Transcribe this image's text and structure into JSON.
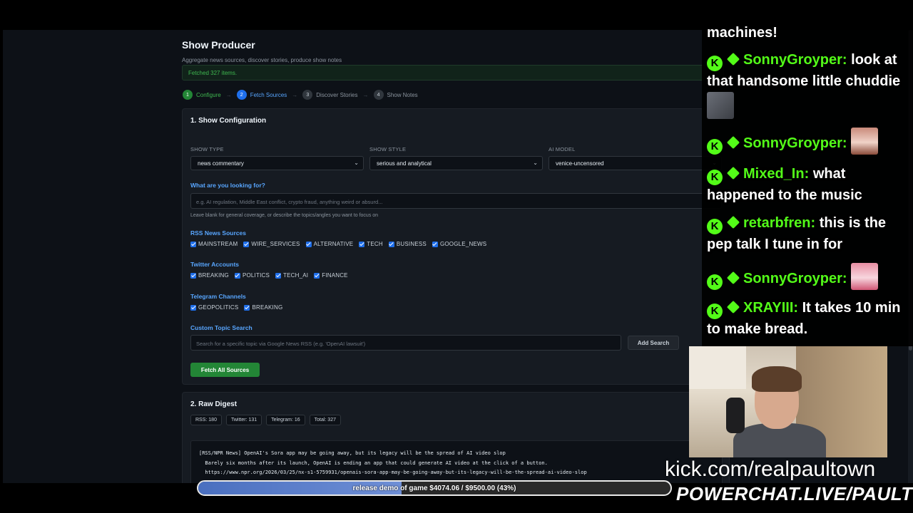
{
  "app": {
    "title": "Show Producer",
    "subtitle": "Aggregate news sources, discover stories, produce show notes",
    "status": "Fetched 327 items."
  },
  "steps": [
    {
      "num": "1",
      "label": "Configure",
      "state": "done"
    },
    {
      "num": "2",
      "label": "Fetch Sources",
      "state": "active"
    },
    {
      "num": "3",
      "label": "Discover Stories",
      "state": "pending"
    },
    {
      "num": "4",
      "label": "Show Notes",
      "state": "pending"
    }
  ],
  "config": {
    "heading": "1. Show Configuration",
    "show_type": {
      "label": "SHOW TYPE",
      "value": "news commentary"
    },
    "show_style": {
      "label": "SHOW STYLE",
      "value": "serious and analytical"
    },
    "ai_model": {
      "label": "AI MODEL",
      "value": "venice-uncensored"
    },
    "looking_for": {
      "label": "What are you looking for?",
      "placeholder": "e.g. AI regulation, Middle East conflict, crypto fraud, anything weird or absurd...",
      "hint": "Leave blank for general coverage, or describe the topics/angles you want to focus on"
    },
    "rss": {
      "label": "RSS News Sources",
      "items": [
        "MAINSTREAM",
        "WIRE_SERVICES",
        "ALTERNATIVE",
        "TECH",
        "BUSINESS",
        "GOOGLE_NEWS"
      ]
    },
    "twitter": {
      "label": "Twitter Accounts",
      "items": [
        "BREAKING",
        "POLITICS",
        "TECH_AI",
        "FINANCE"
      ]
    },
    "telegram": {
      "label": "Telegram Channels",
      "items": [
        "GEOPOLITICS",
        "BREAKING"
      ]
    },
    "custom": {
      "label": "Custom Topic Search",
      "placeholder": "Search for a specific topic via Google News RSS (e.g. 'OpenAI lawsuit')",
      "button": "Add Search"
    },
    "fetch_button": "Fetch All Sources"
  },
  "digest": {
    "heading": "2. Raw Digest",
    "stats": [
      "RSS: 180",
      "Twitter: 131",
      "Telegram: 16",
      "Total: 327"
    ],
    "line1": "[RSS/NPR News] OpenAI's Sora app may be going away, but its legacy will be the spread of AI video slop",
    "line2": "  Barely six months after its launch, OpenAI is ending an app that could generate AI video at the click of a button.",
    "line3": "  https://www.npr.org/2026/03/25/nx-s1-5759931/openais-sora-app-may-be-going-away-but-its-legacy-will-be-the-spread-ai-video-slop"
  },
  "chat": {
    "partial": "machines!",
    "messages": [
      {
        "user": "SonnyGroyper:",
        "text": "look at that handsome little chuddie"
      },
      {
        "user": "SonnyGroyper:",
        "text": ""
      },
      {
        "user": "Mixed_In:",
        "text": "what happened to the music"
      },
      {
        "user": "retarbfren:",
        "text": "this is the pep talk I tune in for"
      },
      {
        "user": "SonnyGroyper:",
        "text": ""
      },
      {
        "user": "XRAYIII:",
        "text": "It takes 10 min to make bread."
      }
    ],
    "badge": "K",
    "username_color": "#53fc18"
  },
  "overlay": {
    "kick_url": "kick.com/realpaultown",
    "powerchat": "POWERCHAT.LIVE/PAULTOWN",
    "goal_text": "release demo of game $4074.06 / $9500.00 (43%)",
    "goal_fraction": 0.43
  }
}
